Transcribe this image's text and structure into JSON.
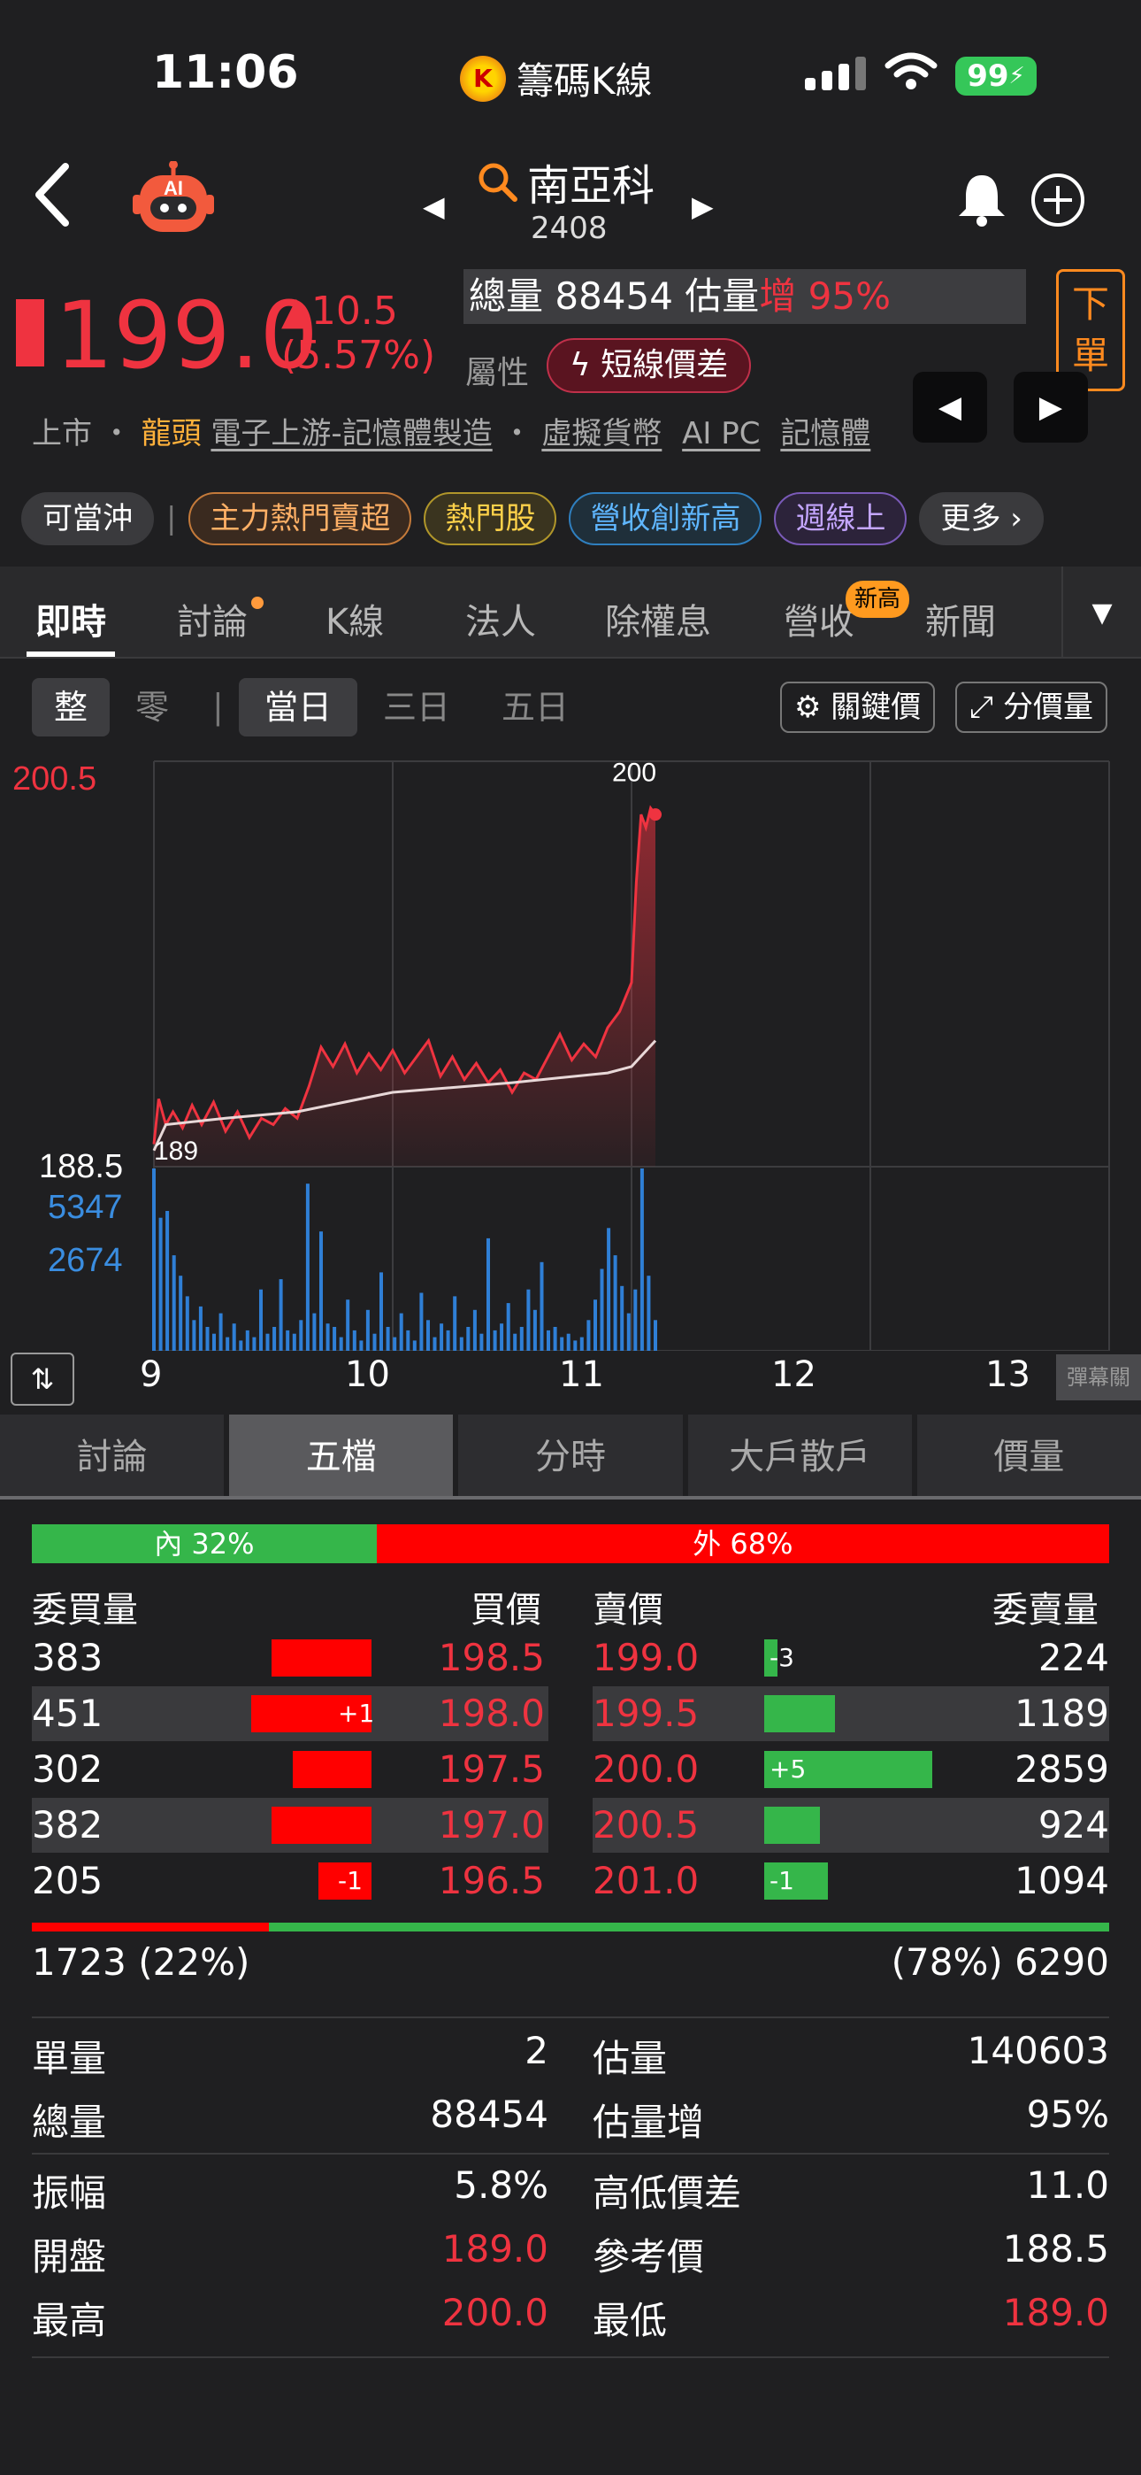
{
  "status": {
    "time": "11:06",
    "app_name": "籌碼K線",
    "battery": "99"
  },
  "header": {
    "stock_name": "南亞科",
    "stock_code": "2408",
    "ai_label": "AI"
  },
  "quote": {
    "price": "199.0",
    "change": "▲10.5",
    "change_pct": "(5.57%)",
    "volume_text": "總量 88454 估量",
    "volume_inc_label": "增 95%",
    "attr_label": "屬性",
    "attr_tag": "短線價差",
    "order_button": "下單"
  },
  "industry": {
    "market": "上市",
    "lead": "龍頭",
    "links": [
      "電子上游-記憶體製造",
      "虛擬貨幣",
      "AI PC",
      "記憶體"
    ]
  },
  "tags": {
    "day_trade": "可當沖",
    "items": [
      "主力熱門賣超",
      "熱門股",
      "營收創新高",
      "週線上"
    ],
    "more": "更多"
  },
  "tabs": {
    "items": [
      "即時",
      "討論",
      "K線",
      "法人",
      "除權息",
      "營收",
      "新聞"
    ],
    "new_high_badge": "新高"
  },
  "chart_controls": {
    "whole": "整",
    "odd": "零",
    "ranges": [
      "當日",
      "三日",
      "五日"
    ],
    "key_price": "關鍵價",
    "price_volume": "分價量"
  },
  "chart_data": {
    "type": "line",
    "ylim": [
      188.5,
      200.5
    ],
    "x_ticks": [
      "9",
      "10",
      "11",
      "12",
      "13"
    ],
    "y_labels": {
      "top": "200.5",
      "bottom": "188.5",
      "vol_max": "5347",
      "vol_mid": "2674"
    },
    "annotations": {
      "high": "200",
      "low": "189"
    },
    "price_series": [
      {
        "t": 9.0,
        "p": 189.2
      },
      {
        "t": 9.02,
        "p": 190.6
      },
      {
        "t": 9.05,
        "p": 189.8
      },
      {
        "t": 9.08,
        "p": 190.2
      },
      {
        "t": 9.12,
        "p": 189.7
      },
      {
        "t": 9.16,
        "p": 190.4
      },
      {
        "t": 9.2,
        "p": 189.8
      },
      {
        "t": 9.25,
        "p": 190.5
      },
      {
        "t": 9.3,
        "p": 189.6
      },
      {
        "t": 9.35,
        "p": 190.2
      },
      {
        "t": 9.4,
        "p": 189.4
      },
      {
        "t": 9.45,
        "p": 190.0
      },
      {
        "t": 9.5,
        "p": 189.8
      },
      {
        "t": 9.55,
        "p": 190.3
      },
      {
        "t": 9.6,
        "p": 190.0
      },
      {
        "t": 9.65,
        "p": 191.0
      },
      {
        "t": 9.7,
        "p": 192.2
      },
      {
        "t": 9.75,
        "p": 191.6
      },
      {
        "t": 9.8,
        "p": 192.3
      },
      {
        "t": 9.85,
        "p": 191.4
      },
      {
        "t": 9.9,
        "p": 192.0
      },
      {
        "t": 9.95,
        "p": 191.5
      },
      {
        "t": 10.0,
        "p": 192.1
      },
      {
        "t": 10.05,
        "p": 191.4
      },
      {
        "t": 10.1,
        "p": 191.9
      },
      {
        "t": 10.15,
        "p": 192.4
      },
      {
        "t": 10.2,
        "p": 191.3
      },
      {
        "t": 10.25,
        "p": 191.9
      },
      {
        "t": 10.3,
        "p": 191.2
      },
      {
        "t": 10.35,
        "p": 191.7
      },
      {
        "t": 10.4,
        "p": 191.1
      },
      {
        "t": 10.45,
        "p": 191.5
      },
      {
        "t": 10.5,
        "p": 190.8
      },
      {
        "t": 10.55,
        "p": 191.4
      },
      {
        "t": 10.6,
        "p": 191.2
      },
      {
        "t": 10.65,
        "p": 191.9
      },
      {
        "t": 10.7,
        "p": 192.6
      },
      {
        "t": 10.75,
        "p": 191.8
      },
      {
        "t": 10.8,
        "p": 192.3
      },
      {
        "t": 10.85,
        "p": 191.9
      },
      {
        "t": 10.9,
        "p": 192.8
      },
      {
        "t": 10.95,
        "p": 193.3
      },
      {
        "t": 11.0,
        "p": 194.2
      },
      {
        "t": 11.02,
        "p": 197.3
      },
      {
        "t": 11.04,
        "p": 199.4
      },
      {
        "t": 11.06,
        "p": 199.0
      },
      {
        "t": 11.08,
        "p": 199.6
      },
      {
        "t": 11.1,
        "p": 199.4
      }
    ],
    "avg_series": [
      {
        "t": 9.0,
        "p": 189.0
      },
      {
        "t": 9.05,
        "p": 189.8
      },
      {
        "t": 9.3,
        "p": 190.0
      },
      {
        "t": 9.6,
        "p": 190.2
      },
      {
        "t": 10.0,
        "p": 190.8
      },
      {
        "t": 10.5,
        "p": 191.1
      },
      {
        "t": 10.9,
        "p": 191.4
      },
      {
        "t": 11.0,
        "p": 191.6
      },
      {
        "t": 11.1,
        "p": 192.4
      }
    ],
    "volume_series": [
      5347,
      3900,
      4100,
      2800,
      2200,
      1600,
      900,
      1300,
      700,
      500,
      1100,
      400,
      800,
      300,
      600,
      400,
      1800,
      500,
      700,
      2100,
      600,
      500,
      900,
      4900,
      1100,
      3500,
      800,
      700,
      400,
      1500,
      600,
      300,
      1200,
      500,
      2300,
      700,
      400,
      1100,
      600,
      300,
      1700,
      900,
      400,
      800,
      600,
      1600,
      400,
      700,
      1200,
      500,
      3300,
      600,
      800,
      1400,
      500,
      700,
      1800,
      1200,
      2600,
      600,
      700,
      400,
      500,
      300,
      400,
      900,
      1500,
      2400,
      3600,
      2800,
      1900,
      1100,
      1800,
      5347,
      2200,
      900
    ]
  },
  "chart_misc": {
    "barrage": "彈幕關"
  },
  "subtabs": [
    "討論",
    "五檔",
    "分時",
    "大戶散戶",
    "價量"
  ],
  "order_book": {
    "inner": "內 32%",
    "outer": "外 68%",
    "inner_pct": 32,
    "headers": {
      "bid_vol": "委買量",
      "bid": "買價",
      "ask": "賣價",
      "ask_vol": "委賣量"
    },
    "bids": [
      {
        "vol": "383",
        "price": "198.5",
        "delta": "",
        "share": 0.58
      },
      {
        "vol": "451",
        "price": "198.0",
        "delta": "+1",
        "share": 0.7
      },
      {
        "vol": "302",
        "price": "197.5",
        "delta": "",
        "share": 0.46
      },
      {
        "vol": "382",
        "price": "197.0",
        "delta": "",
        "share": 0.58
      },
      {
        "vol": "205",
        "price": "196.5",
        "delta": "-1",
        "share": 0.31
      }
    ],
    "asks": [
      {
        "vol": "224",
        "price": "199.0",
        "delta": "-3",
        "share": 0.08
      },
      {
        "vol": "1189",
        "price": "199.5",
        "delta": "",
        "share": 0.42
      },
      {
        "vol": "2859",
        "price": "200.0",
        "delta": "+5",
        "share": 1.0
      },
      {
        "vol": "924",
        "price": "200.5",
        "delta": "",
        "share": 0.33
      },
      {
        "vol": "1094",
        "price": "201.0",
        "delta": "-1",
        "share": 0.38
      }
    ],
    "bid_total": "1723 (22%)",
    "ask_total": "(78%) 6290",
    "bid_ratio": 22
  },
  "stats": {
    "single_vol_label": "單量",
    "single_vol": "2",
    "est_vol_label": "估量",
    "est_vol": "140603",
    "total_vol_label": "總量",
    "total_vol": "88454",
    "est_inc_label": "估量增",
    "est_inc": "95%",
    "amplitude_label": "振幅",
    "amplitude": "5.8%",
    "hl_diff_label": "高低價差",
    "hl_diff": "11.0",
    "open_label": "開盤",
    "open": "189.0",
    "ref_label": "參考價",
    "ref": "188.5",
    "high_label": "最高",
    "high": "200.0",
    "low_label": "最低",
    "low": "189.0"
  },
  "colors": {
    "up": "#ef3340",
    "down": "#3cc456",
    "accent": "#ff8a1f",
    "volume": "#2f7fd6"
  }
}
